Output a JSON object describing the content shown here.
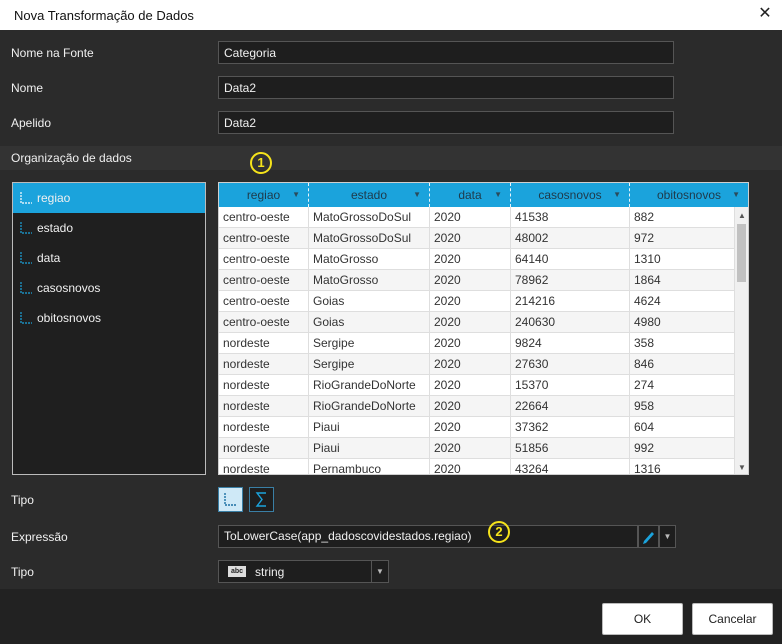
{
  "dialog": {
    "title": "Nova Transformação de Dados"
  },
  "fields": {
    "nome_na_fonte": {
      "label": "Nome na Fonte",
      "value": "Categoria"
    },
    "nome": {
      "label": "Nome",
      "value": "Data2"
    },
    "apelido": {
      "label": "Apelido",
      "value": "Data2"
    }
  },
  "organizacao": {
    "label": "Organização de dados",
    "columns": [
      "regiao",
      "estado",
      "data",
      "casosnovos",
      "obitosnovos"
    ],
    "selected": "regiao"
  },
  "badges": {
    "one": "1",
    "two": "2"
  },
  "grid": {
    "headers": [
      "regiao",
      "estado",
      "data",
      "casosnovos",
      "obitosnovos"
    ],
    "rows": [
      [
        "centro-oeste",
        "MatoGrossoDoSul",
        "2020",
        "41538",
        "882"
      ],
      [
        "centro-oeste",
        "MatoGrossoDoSul",
        "2020",
        "48002",
        "972"
      ],
      [
        "centro-oeste",
        "MatoGrosso",
        "2020",
        "64140",
        "1310"
      ],
      [
        "centro-oeste",
        "MatoGrosso",
        "2020",
        "78962",
        "1864"
      ],
      [
        "centro-oeste",
        "Goias",
        "2020",
        "214216",
        "4624"
      ],
      [
        "centro-oeste",
        "Goias",
        "2020",
        "240630",
        "4980"
      ],
      [
        "nordeste",
        "Sergipe",
        "2020",
        "9824",
        "358"
      ],
      [
        "nordeste",
        "Sergipe",
        "2020",
        "27630",
        "846"
      ],
      [
        "nordeste",
        "RioGrandeDoNorte",
        "2020",
        "15370",
        "274"
      ],
      [
        "nordeste",
        "RioGrandeDoNorte",
        "2020",
        "22664",
        "958"
      ],
      [
        "nordeste",
        "Piaui",
        "2020",
        "37362",
        "604"
      ],
      [
        "nordeste",
        "Piaui",
        "2020",
        "51856",
        "992"
      ],
      [
        "nordeste",
        "Pernambuco",
        "2020",
        "43264",
        "1316"
      ]
    ]
  },
  "tipo": {
    "label": "Tipo",
    "options": [
      "dimension-icon",
      "sum-icon"
    ]
  },
  "expressao": {
    "label": "Expressão",
    "value": "ToLowerCase(app_dadoscovidestados.regiao)"
  },
  "tipo_dado": {
    "label": "Tipo",
    "badge": "abc",
    "value": "string"
  },
  "buttons": {
    "ok": "OK",
    "cancel": "Cancelar"
  },
  "colors": {
    "accent": "#1ba3dc",
    "badge": "#f5e31b",
    "background": "#2b2b2b"
  }
}
